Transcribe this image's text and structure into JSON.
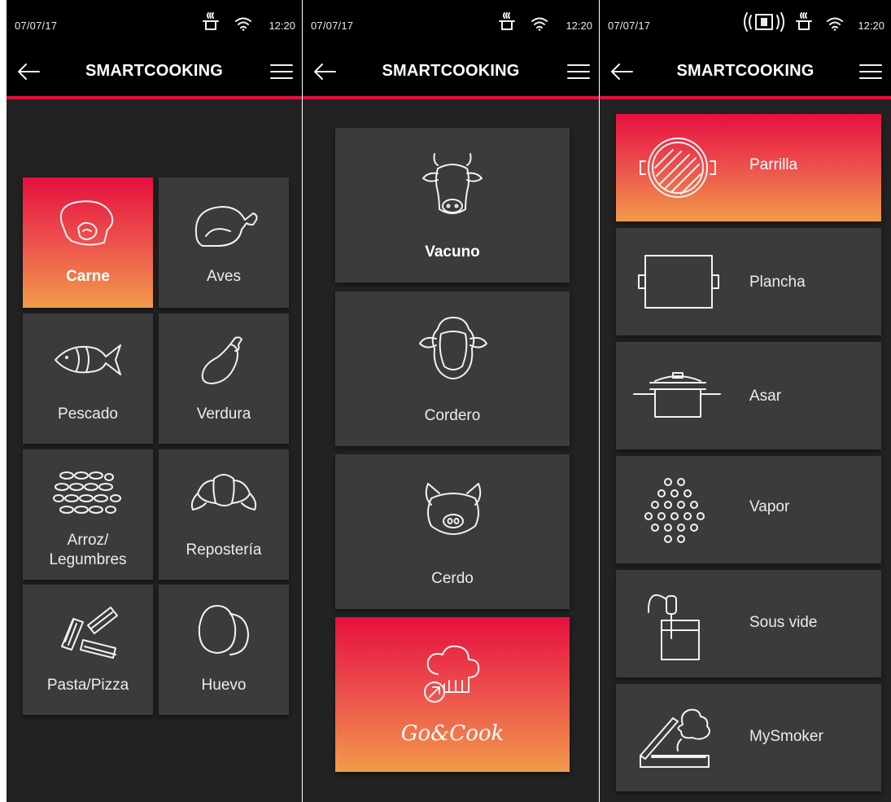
{
  "colors": {
    "accent": "#e2123e",
    "gradient_top": "#e6103e",
    "gradient_bottom": "#f29a4a",
    "tile": "#3b3b3b",
    "background": "#222222"
  },
  "screens": [
    {
      "status": {
        "date": "07/07/17",
        "time": "12:20"
      },
      "appbar": {
        "title": "SMARTCOOKING"
      },
      "categories": [
        {
          "label": "Carne",
          "icon": "meat-icon",
          "active": true
        },
        {
          "label": "Aves",
          "icon": "chicken-icon"
        },
        {
          "label": "Pescado",
          "icon": "fish-icon"
        },
        {
          "label": "Verdura",
          "icon": "eggplant-icon"
        },
        {
          "label": "Arroz/",
          "label2": "Legumbres",
          "icon": "rice-icon"
        },
        {
          "label": "Repostería",
          "icon": "croissant-icon"
        },
        {
          "label": "Pasta/Pizza",
          "icon": "pasta-icon"
        },
        {
          "label": "Huevo",
          "icon": "egg-icon"
        }
      ]
    },
    {
      "status": {
        "date": "07/07/17",
        "time": "12:20"
      },
      "appbar": {
        "title": "SMARTCOOKING"
      },
      "items": [
        {
          "label": "Vacuno",
          "icon": "cow-icon"
        },
        {
          "label": "Cordero",
          "icon": "sheep-icon"
        },
        {
          "label": "Cerdo",
          "icon": "pig-icon"
        },
        {
          "label": "Go&Cook",
          "icon": "chef-hat-icon",
          "active": true
        }
      ]
    },
    {
      "status": {
        "date": "07/07/17",
        "time": "12:20"
      },
      "appbar": {
        "title": "SMARTCOOKING"
      },
      "methods": [
        {
          "label": "Parrilla",
          "icon": "grill-icon",
          "active": true
        },
        {
          "label": "Plancha",
          "icon": "griddle-icon"
        },
        {
          "label": "Asar",
          "icon": "roasting-pot-icon"
        },
        {
          "label": "Vapor",
          "icon": "steam-icon"
        },
        {
          "label": "Sous vide",
          "icon": "sous-vide-icon"
        },
        {
          "label": "MySmoker",
          "icon": "smoker-icon"
        }
      ]
    }
  ]
}
